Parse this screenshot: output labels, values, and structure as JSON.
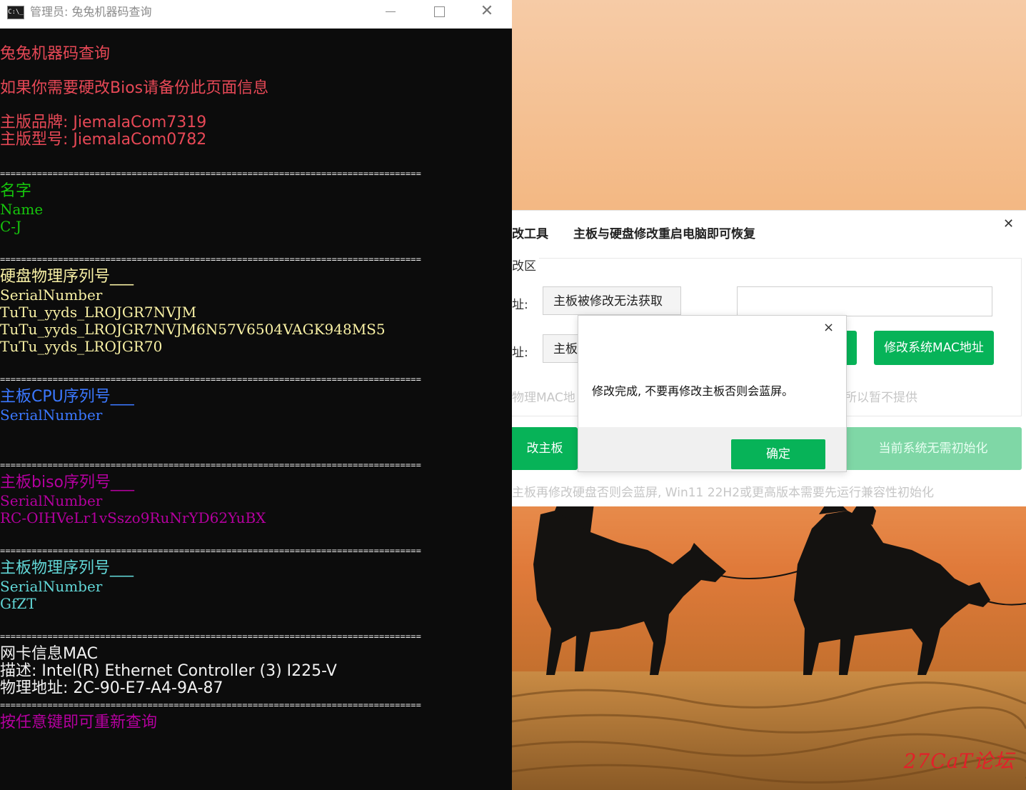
{
  "console": {
    "title": "管理员: 兔兔机器码查询",
    "title_icon": "C:\\_",
    "lines": {
      "l1": "兔兔机器码查询",
      "l2": "如果你需要硬改Bios请备份此页面信息",
      "l3": "主版品牌: JiemalaCom7319",
      "l4": "主版型号: JiemalaCom0782",
      "sep": "================================================================================",
      "name_h": "名字",
      "name_k": "Name",
      "name_v": "C-J",
      "disk_h": "硬盘物理序列号___",
      "disk_k": "SerialNumber",
      "disk_v1": "TuTu_yyds_LROJGR7NVJM",
      "disk_v2": "TuTu_yyds_LROJGR7NVJM6N57V6504VAGK948MS5",
      "disk_v3": "TuTu_yyds_LROJGR70",
      "cpu_h": "主板CPU序列号___",
      "cpu_k": "SerialNumber",
      "bios_h": "主板biso序列号___",
      "bios_k": "SerialNumber",
      "bios_v": "RC-OIHVeLr1vSszo9RuNrYD62YuBX",
      "board_h": "主板物理序列号___",
      "board_k": "SerialNumber",
      "board_v": "GfZT",
      "mac_h": "网卡信息MAC",
      "mac_desc": "描述: Intel(R) Ethernet Controller (3) I225-V",
      "mac_addr": "物理地址: 2C-90-E7-A4-9A-87",
      "footer": "按任意键即可重新查询"
    }
  },
  "tool": {
    "title_partial": "改工具",
    "subtitle": "主板与硬盘修改重启电脑即可恢复",
    "group_label": "改区",
    "label1": "址:",
    "label2": "址:",
    "box1": "主板被修改无法获取",
    "box2": "主板",
    "mac_button": "修改系统MAC地址",
    "faint_left": "物理MAC地",
    "faint_right": "所以暂不提供",
    "modify_board_button": "改主板",
    "init_button": "当前系统无需初始化",
    "warning": "主板再修改硬盘否则会蓝屏, Win11 22H2或更高版本需要先运行兼容性初始化"
  },
  "dialog": {
    "message": "修改完成, 不要再修改主板否则会蓝屏。",
    "ok_label": "确定",
    "close_glyph": "×"
  },
  "watermark": "27CaT论坛"
}
